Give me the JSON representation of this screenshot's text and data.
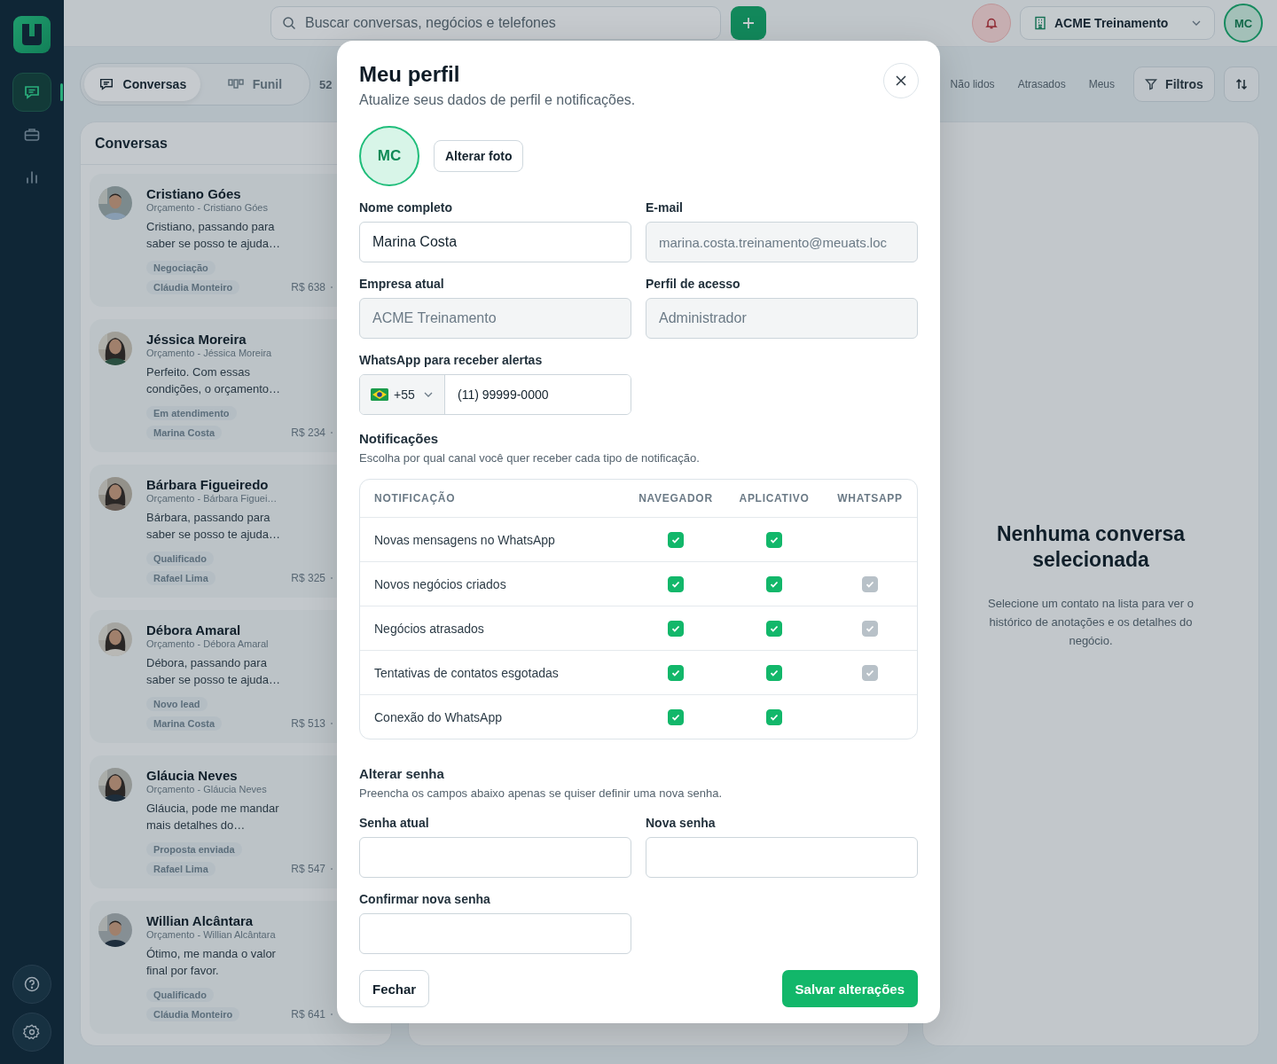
{
  "sidebar": {
    "items": [
      {
        "kind": "chat",
        "selected": true
      },
      {
        "kind": "briefcase",
        "selected": false
      },
      {
        "kind": "chart",
        "selected": false
      }
    ]
  },
  "topbar": {
    "search_placeholder": "Buscar conversas, negócios e telefones",
    "company": "ACME Treinamento",
    "avatar": "MC"
  },
  "view_tabs": [
    {
      "label": "Conversas",
      "kind": "chat",
      "selected": true
    },
    {
      "label": "Funil",
      "kind": "funnel",
      "selected": false
    }
  ],
  "view_count": "52",
  "filters": {
    "tabs": [
      "Não lidos",
      "Atrasados",
      "Meus"
    ],
    "button": "Filtros"
  },
  "conversations": {
    "title": "Conversas",
    "items": [
      {
        "name": "Cristiano Góes",
        "subtitle": "Orçamento - Cristiano Góes",
        "message": "Cristiano, passando para saber se posso te ajuda…",
        "stage": "Negociação",
        "owner": "Cláudia Monteiro",
        "value": "R$ 638"
      },
      {
        "name": "Jéssica Moreira",
        "subtitle": "Orçamento - Jéssica Moreira",
        "message": "Perfeito. Com essas condições, o orçamento…",
        "stage": "Em atendimento",
        "owner": "Marina Costa",
        "value": "R$ 234"
      },
      {
        "name": "Bárbara Figueiredo",
        "subtitle": "Orçamento - Bárbara Figuei…",
        "message": "Bárbara, passando para saber se posso te ajuda…",
        "stage": "Qualificado",
        "owner": "Rafael Lima",
        "value": "R$ 325"
      },
      {
        "name": "Débora Amaral",
        "subtitle": "Orçamento - Débora Amaral",
        "message": "Débora, passando para saber se posso te ajuda…",
        "stage": "Novo lead",
        "owner": "Marina Costa",
        "value": "R$ 513"
      },
      {
        "name": "Gláucia Neves",
        "subtitle": "Orçamento - Gláucia Neves",
        "message": "Gláucia, pode me mandar mais detalhes do…",
        "stage": "Proposta enviada",
        "owner": "Rafael Lima",
        "value": "R$ 547"
      },
      {
        "name": "Willian Alcântara",
        "subtitle": "Orçamento - Willian Alcântara",
        "message": "Ótimo, me manda o valor final por favor.",
        "stage": "Qualificado",
        "owner": "Cláudia Monteiro",
        "value": "R$ 641"
      }
    ]
  },
  "empty_state": {
    "title": "Nenhuma conversa selecionada",
    "text": "Selecione um contato na lista para ver o histórico de anotações e os detalhes do negócio."
  },
  "modal": {
    "title": "Meu perfil",
    "subtitle": "Atualize seus dados de perfil e notificações.",
    "avatar": "MC",
    "change_photo": "Alterar foto",
    "fields": [
      {
        "label": "Nome completo",
        "value": "Marina Costa",
        "disabled": false
      },
      {
        "label": "E-mail",
        "value": "marina.costa.treinamento@meuats.loc",
        "disabled": true
      },
      {
        "label": "Empresa atual",
        "value": "ACME Treinamento",
        "disabled": true
      },
      {
        "label": "Perfil de acesso",
        "value": "Administrador",
        "disabled": true
      }
    ],
    "phone": {
      "label": "WhatsApp para receber alertas",
      "country_code": "+55",
      "value": "(11) 99999-0000"
    },
    "notifications": {
      "title": "Notificações",
      "text": "Escolha por qual canal você quer receber cada tipo de notificação.",
      "columns": [
        "NOTIFICAÇÃO",
        "NAVEGADOR",
        "APLICATIVO",
        "WHATSAPP"
      ],
      "rows": [
        {
          "label": "Novas mensagens no WhatsApp",
          "cells": [
            {
              "kind": "checkbox",
              "checked": true,
              "disabled": false
            },
            {
              "kind": "checkbox",
              "checked": true,
              "disabled": false
            },
            {
              "kind": "empty"
            }
          ]
        },
        {
          "label": "Novos negócios criados",
          "cells": [
            {
              "kind": "checkbox",
              "checked": true,
              "disabled": false
            },
            {
              "kind": "checkbox",
              "checked": true,
              "disabled": false
            },
            {
              "kind": "checkbox",
              "checked": true,
              "disabled": true
            }
          ]
        },
        {
          "label": "Negócios atrasados",
          "cells": [
            {
              "kind": "checkbox",
              "checked": true,
              "disabled": false
            },
            {
              "kind": "checkbox",
              "checked": true,
              "disabled": false
            },
            {
              "kind": "checkbox",
              "checked": true,
              "disabled": true
            }
          ]
        },
        {
          "label": "Tentativas de contatos esgotadas",
          "cells": [
            {
              "kind": "checkbox",
              "checked": true,
              "disabled": false
            },
            {
              "kind": "checkbox",
              "checked": true,
              "disabled": false
            },
            {
              "kind": "checkbox",
              "checked": true,
              "disabled": true
            }
          ]
        },
        {
          "label": "Conexão do WhatsApp",
          "cells": [
            {
              "kind": "checkbox",
              "checked": true,
              "disabled": false
            },
            {
              "kind": "checkbox",
              "checked": true,
              "disabled": false
            },
            {
              "kind": "empty"
            }
          ]
        }
      ]
    },
    "password": {
      "title": "Alterar senha",
      "text": "Preencha os campos abaixo apenas se quiser definir uma nova senha.",
      "fields": [
        {
          "label": "Senha atual"
        },
        {
          "label": "Nova senha"
        },
        {
          "label": "Confirmar nova senha"
        }
      ]
    },
    "close_button": "Fechar",
    "save_button": "Salvar alterações"
  }
}
